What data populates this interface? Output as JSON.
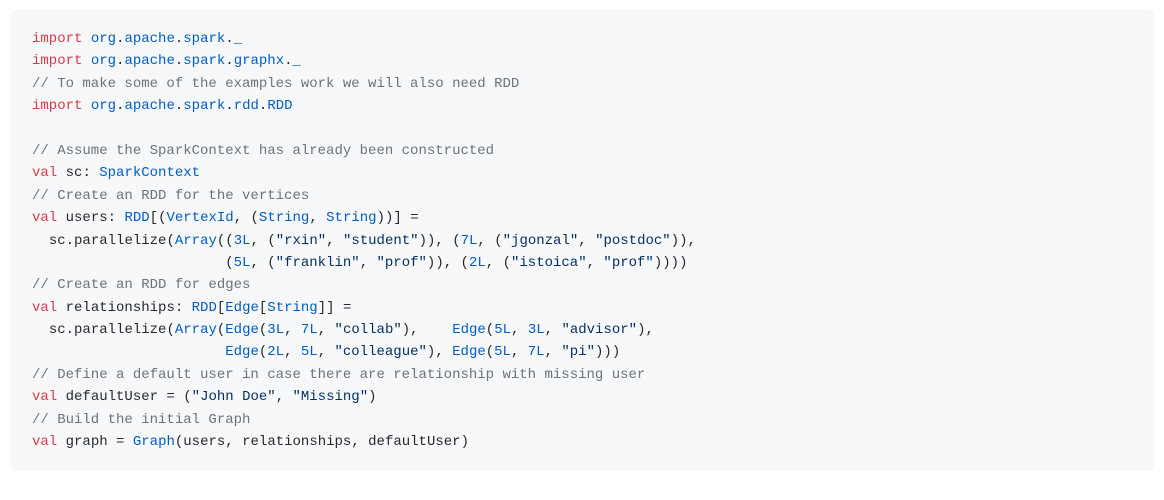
{
  "code": {
    "kw_import": "import",
    "kw_val": "val",
    "ns_org": "org",
    "ns_apache": "apache",
    "ns_spark": "spark",
    "ns_graphx": "graphx",
    "ns_rdd": "rdd",
    "cls_RDD": "RDD",
    "cls_SparkContext": "SparkContext",
    "cls_VertexId": "VertexId",
    "cls_String": "String",
    "cls_Edge": "Edge",
    "cls_Array": "Array",
    "cls_Graph": "Graph",
    "wild": "_",
    "dot": ".",
    "comma": ",",
    "colon": ":",
    "eq": "=",
    "lparen": "(",
    "rparen": ")",
    "lbrack": "[",
    "rbrack": "]",
    "id_sc": "sc",
    "id_users": "users",
    "id_relationships": "relationships",
    "id_defaultUser": "defaultUser",
    "id_graph": "graph",
    "m_parallelize": "parallelize",
    "cmt1": "// To make some of the examples work we will also need RDD",
    "cmt2": "// Assume the SparkContext has already been constructed",
    "cmt3": "// Create an RDD for the vertices",
    "cmt4": "// Create an RDD for edges",
    "cmt5": "// Define a default user in case there are relationship with missing user",
    "cmt6": "// Build the initial Graph",
    "n3L": "3L",
    "n5L": "5L",
    "n7L": "7L",
    "n2L": "2L",
    "s_rxin": "\"rxin\"",
    "s_student": "\"student\"",
    "s_jgonzal": "\"jgonzal\"",
    "s_postdoc": "\"postdoc\"",
    "s_franklin": "\"franklin\"",
    "s_prof": "\"prof\"",
    "s_istoica": "\"istoica\"",
    "s_collab": "\"collab\"",
    "s_advisor": "\"advisor\"",
    "s_colleague": "\"colleague\"",
    "s_pi": "\"pi\"",
    "s_johndoe": "\"John Doe\"",
    "s_missing": "\"Missing\"",
    "sp": " ",
    "sp2": "  ",
    "sp_arr2": "                       ",
    "sp_edge2": "                       ",
    "sp_edge_gap": "    "
  }
}
